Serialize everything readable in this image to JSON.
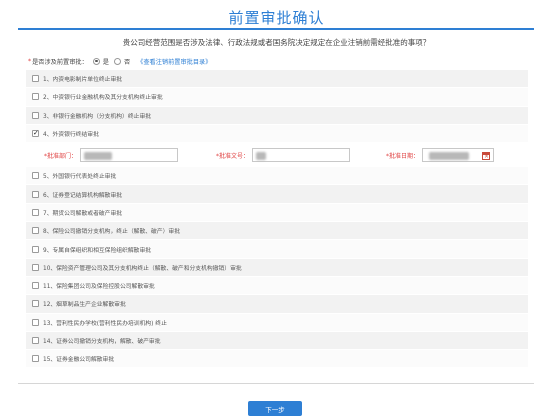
{
  "header": {
    "title": "前置审批确认",
    "question": "贵公司经营范围是否涉及法律、行政法规或者国务院决定规定在企业注销前需经批准的事项？"
  },
  "approval": {
    "required_mark": "*",
    "label": "是否涉及前置审批：",
    "yes": "是",
    "no": "否",
    "selected": "是",
    "catalog_link": "《查看注销前置审批目录》"
  },
  "items": [
    {
      "label": "1、内资电影制片单位终止审批",
      "checked": false
    },
    {
      "label": "2、中资银行业金融机构及其分支机构终止审批",
      "checked": false
    },
    {
      "label": "3、非银行金融机构（分支机构）终止审批",
      "checked": false
    },
    {
      "label": "4、外资银行终结审批",
      "checked": true
    },
    {
      "label": "5、外国银行代表处终止审批",
      "checked": false
    },
    {
      "label": "6、证券登记结算机构解散审批",
      "checked": false
    },
    {
      "label": "7、期货公司解散或者破产审批",
      "checked": false
    },
    {
      "label": "8、保险公司撤销分支机构，终止（解散、破产）审批",
      "checked": false
    },
    {
      "label": "9、专属自保组织和相互保险组织解散审批",
      "checked": false
    },
    {
      "label": "10、保险资产管理公司及其分支机构终止（解散、破产和分支机构撤销）审批",
      "checked": false
    },
    {
      "label": "11、保险集团公司及保险控股公司解散审批",
      "checked": false
    },
    {
      "label": "12、烟草制品生产企业解散审批",
      "checked": false
    },
    {
      "label": "13、营利性民办学校(营利性民办培训机构) 终止",
      "checked": false
    },
    {
      "label": "14、证券公司撤销分支机构，解散、破产审批",
      "checked": false
    },
    {
      "label": "15、证券金融公司解散审批",
      "checked": false
    }
  ],
  "detail": {
    "department_label": "*批准部门：",
    "doc_no_label": "*批准文号：",
    "date_label": "*批准日期："
  },
  "footer": {
    "next_label": "下一步"
  },
  "colors": {
    "accent": "#2e7fd4",
    "required": "#e04040"
  }
}
